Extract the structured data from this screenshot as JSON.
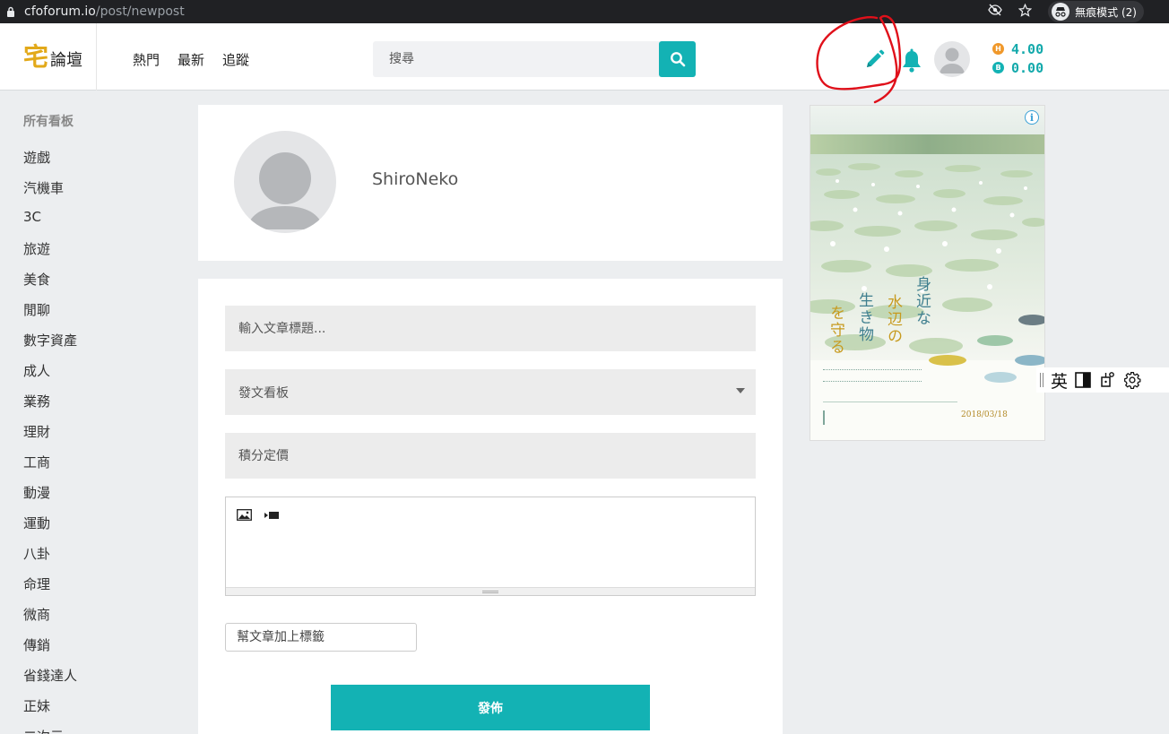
{
  "browser": {
    "url_host": "cfoforum.io",
    "url_path": "/post/newpost",
    "incognito_label": "無痕模式 (2)"
  },
  "header": {
    "logo_main": "宅",
    "logo_sub": "論壇",
    "nav": [
      "熱門",
      "最新",
      "追蹤"
    ],
    "search_placeholder": "搜尋",
    "balance_gold": "4.00",
    "balance_b": "0.00",
    "coin_gold_letter": "H",
    "coin_teal_letter": "B"
  },
  "sidebar": {
    "title": "所有看板",
    "items": [
      "遊戲",
      "汽機車",
      "3C",
      "旅遊",
      "美食",
      "閒聊",
      "數字資產",
      "成人",
      "業務",
      "理財",
      "工商",
      "動漫",
      "運動",
      "八卦",
      "命理",
      "微商",
      "傳銷",
      "省錢達人",
      "正妹",
      "二次元"
    ]
  },
  "profile": {
    "username": "ShiroNeko"
  },
  "form": {
    "title_placeholder": "輸入文章標題...",
    "board_select": "發文看板",
    "price_placeholder": "積分定價",
    "tags_placeholder": "幫文章加上標籤",
    "publish_label": "發佈"
  },
  "ad": {
    "info_glyph": "i",
    "headline_col1": "身近な",
    "headline_col2": "水辺の",
    "headline_col3": "生き物",
    "headline_col4": "を守る",
    "date_text": "2018/03/18"
  },
  "ime": {
    "lang": "英"
  },
  "colors": {
    "accent": "#13b2b4",
    "logo_gold": "#e2a91a",
    "coin_gold": "#f0982a",
    "annotation_red": "#e0101a"
  }
}
